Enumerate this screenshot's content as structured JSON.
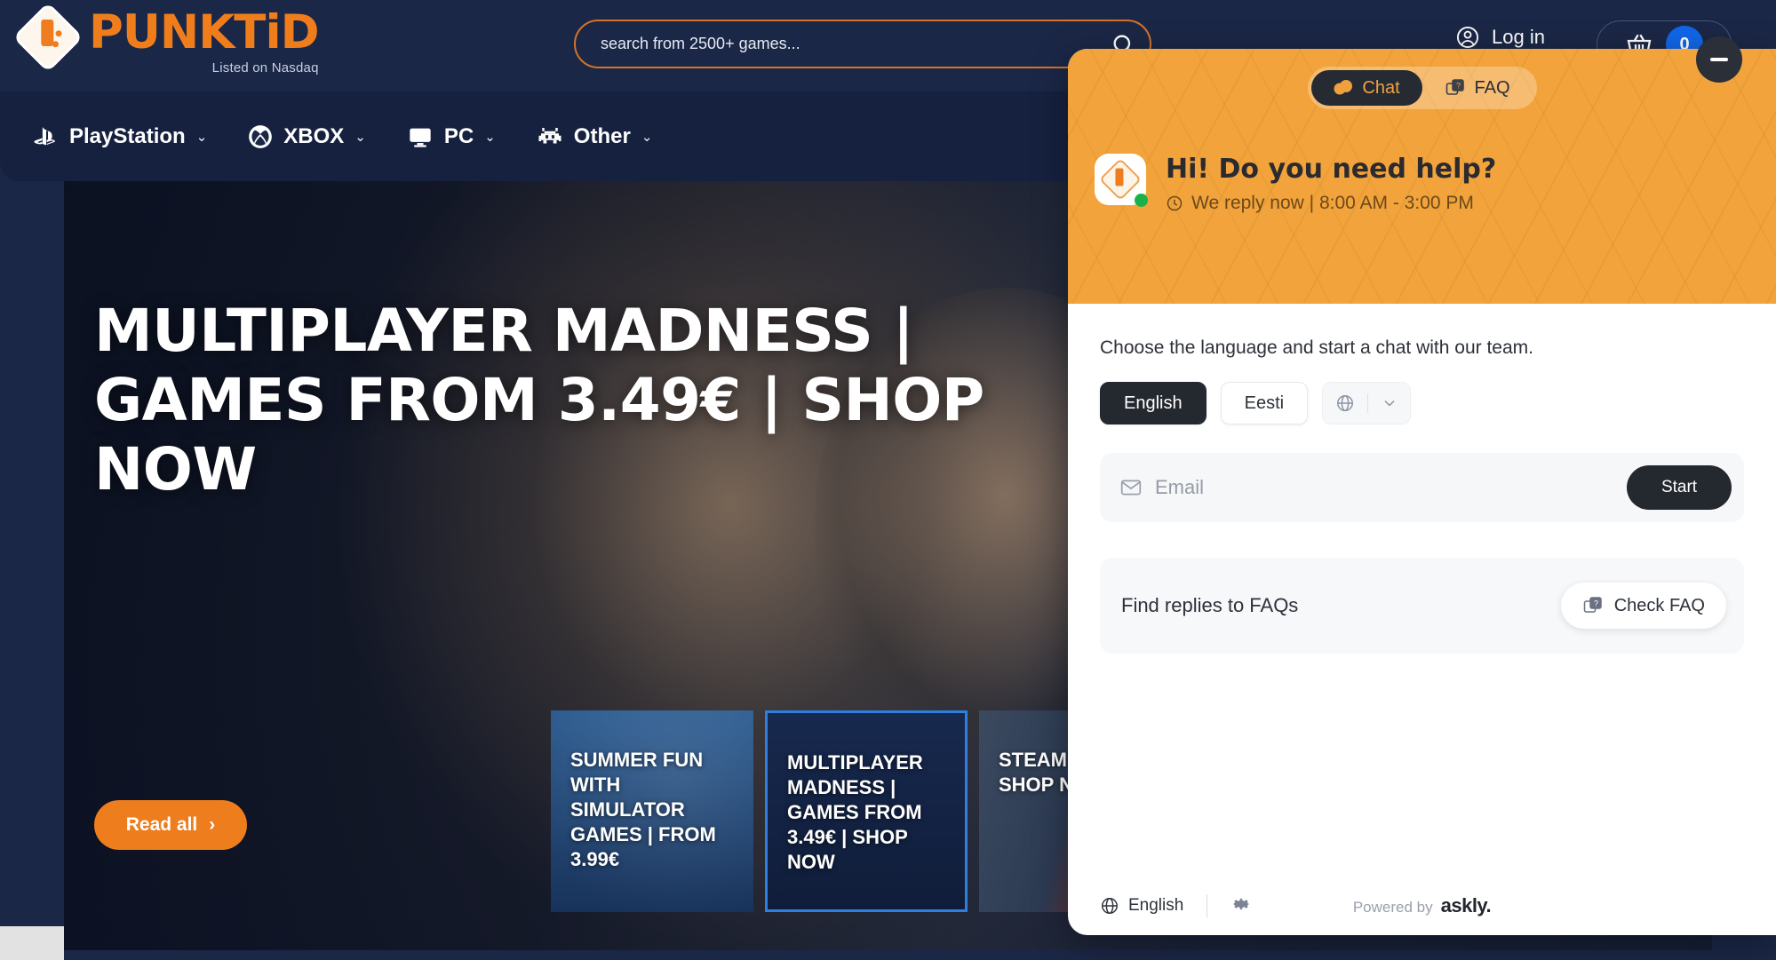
{
  "header": {
    "logo_text": "PUNKTiD",
    "logo_subtitle": "Listed on Nasdaq",
    "search_placeholder": "search from 2500+ games...",
    "search_value": "",
    "login_label": "Log in",
    "cart_count": "0"
  },
  "nav": {
    "items": [
      {
        "label": "PlayStation",
        "icon": "playstation-icon",
        "chevron": "⌄"
      },
      {
        "label": "XBOX",
        "icon": "xbox-icon",
        "chevron": "⌄"
      },
      {
        "label": "PC",
        "icon": "monitor-icon",
        "chevron": "⌄"
      },
      {
        "label": "Other",
        "icon": "alien-icon",
        "chevron": "⌄"
      }
    ]
  },
  "hero": {
    "title": "MULTIPLAYER MADNESS | GAMES FROM 3.49€ | SHOP NOW",
    "cta_label": "Read all",
    "cta_arrow": "›"
  },
  "thumbnails": [
    {
      "label": "SUMMER FUN WITH SIMULATOR GAMES | FROM 3.99€",
      "active": false
    },
    {
      "label": "MULTIPLAYER MADNESS | GAMES FROM 3.49€ | SHOP NOW",
      "active": true
    },
    {
      "label": "STEAM UNDER SHOP N",
      "active": false
    }
  ],
  "chat": {
    "tabs": [
      {
        "label": "Chat",
        "icon": "chat-bubble-icon",
        "active": true
      },
      {
        "label": "FAQ",
        "icon": "faq-icon",
        "active": false
      }
    ],
    "greeting_title": "Hi! Do you need help?",
    "greeting_status": "We reply now | 8:00 AM - 3:00 PM",
    "clock_icon": "ⓘ",
    "choose_text": "Choose the language and start a chat with our team.",
    "languages": [
      {
        "label": "English",
        "selected": true
      },
      {
        "label": "Eesti",
        "selected": false
      }
    ],
    "email_placeholder": "Email",
    "email_value": "",
    "start_label": "Start",
    "faq_text": "Find replies to FAQs",
    "faq_button_label": "Check FAQ",
    "footer_language": "English",
    "powered_by_label": "Powered by",
    "powered_by_brand": "askly."
  },
  "colors": {
    "brand_orange": "#ee7d1e",
    "chat_header_orange": "#f2a33c",
    "navy": "#1b2746",
    "accent_blue": "#1166e8",
    "dark": "#24282f"
  }
}
